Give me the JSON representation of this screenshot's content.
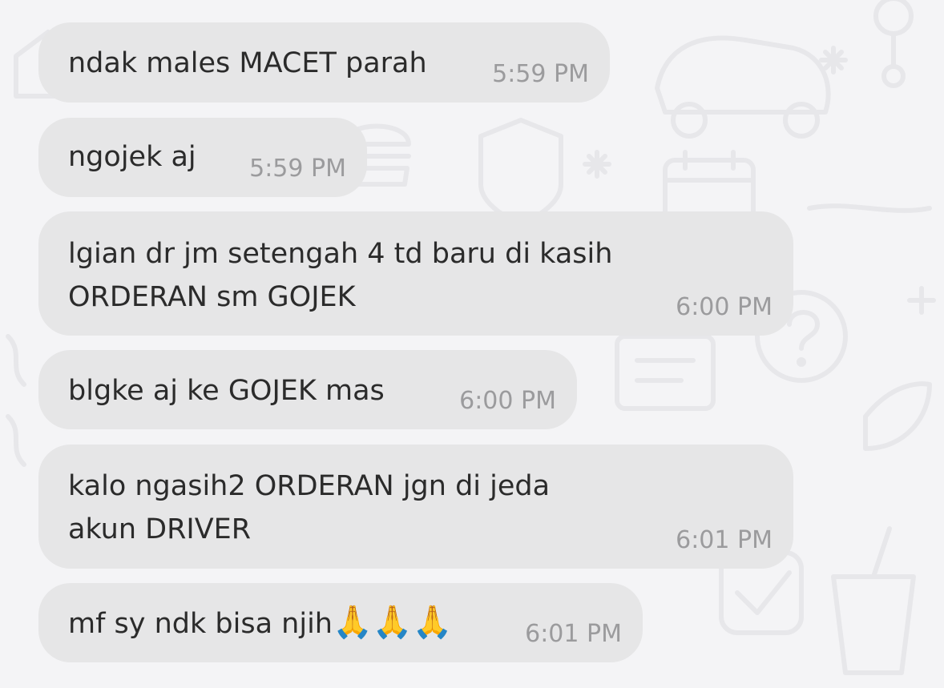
{
  "messages": [
    {
      "text": "ndak males MACET parah",
      "time": "5:59 PM"
    },
    {
      "text": "ngojek aj",
      "time": "5:59 PM"
    },
    {
      "text": "lgian dr jm setengah 4 td baru di kasih\nORDERAN sm GOJEK",
      "time": "6:00 PM"
    },
    {
      "text": "blgke aj ke GOJEK mas",
      "time": "6:00 PM"
    },
    {
      "text": "kalo ngasih2 ORDERAN jgn di jeda\nakun DRIVER",
      "time": "6:01 PM"
    },
    {
      "text": "mf sy ndk bisa njih",
      "emoji": "🙏🙏🙏",
      "time": "6:01 PM"
    }
  ],
  "colors": {
    "background": "#f4f4f6",
    "bubble": "#e6e6e7",
    "text": "#2b2b2b",
    "time": "#9b9b9d"
  },
  "icons": [
    "car-doodle",
    "shield-doodle",
    "burger-doodle",
    "calendar-doodle",
    "question-doodle",
    "note-doodle",
    "drink-doodle",
    "leaf-doodle",
    "check-doodle"
  ]
}
